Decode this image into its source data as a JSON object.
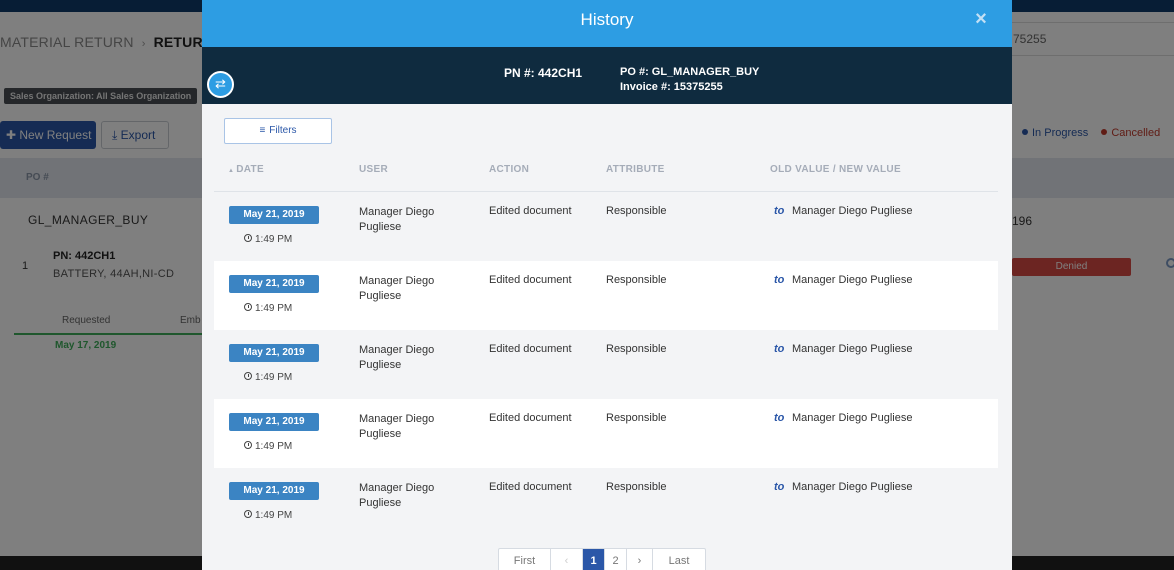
{
  "background": {
    "breadcrumb": {
      "parent": "MATERIAL RETURN",
      "current": "RETURN"
    },
    "search_value": "75255",
    "org_badge": "Sales Organization: All Sales Organization",
    "new_request_label": "New Request",
    "export_label": "Export",
    "legend": {
      "in_progress": "In Progress",
      "cancelled": "Cancelled"
    },
    "table_head_po": "PO #",
    "row_po": "GL_MANAGER_BUY",
    "row_right_value": "196",
    "item": {
      "number": "1",
      "pn": "PN: 442CH1",
      "description": "BATTERY, 44AH,NI-CD"
    },
    "denied_status": "Denied",
    "timeline": {
      "requested": "Requested",
      "emb": "Emb",
      "date": "May 17, 2019"
    }
  },
  "modal": {
    "title": "History",
    "close_glyph": "×",
    "swap_glyph": "⇄",
    "pn_label": "PN #:  442CH1",
    "po_label": "PO #:  GL_MANAGER_BUY",
    "invoice_label": "Invoice #:  15375255",
    "filters_label": "Filters",
    "filters_glyph": "≡",
    "columns": {
      "sort_glyph": "▲",
      "date": "DATE",
      "user": "USER",
      "action": "ACTION",
      "attribute": "ATTRIBUTE",
      "old_new": "OLD VALUE / NEW VALUE"
    },
    "rows": [
      {
        "date": "May 21, 2019",
        "time": "1:49 PM",
        "user": "Manager Diego Pugliese",
        "action": "Edited document",
        "attribute": "Responsible",
        "to": "to",
        "value": "Manager Diego Pugliese"
      },
      {
        "date": "May 21, 2019",
        "time": "1:49 PM",
        "user": "Manager Diego Pugliese",
        "action": "Edited document",
        "attribute": "Responsible",
        "to": "to",
        "value": "Manager Diego Pugliese"
      },
      {
        "date": "May 21, 2019",
        "time": "1:49 PM",
        "user": "Manager Diego Pugliese",
        "action": "Edited document",
        "attribute": "Responsible",
        "to": "to",
        "value": "Manager Diego Pugliese"
      },
      {
        "date": "May 21, 2019",
        "time": "1:49 PM",
        "user": "Manager Diego Pugliese",
        "action": "Edited document",
        "attribute": "Responsible",
        "to": "to",
        "value": "Manager Diego Pugliese"
      },
      {
        "date": "May 21, 2019",
        "time": "1:49 PM",
        "user": "Manager Diego Pugliese",
        "action": "Edited document",
        "attribute": "Responsible",
        "to": "to",
        "value": "Manager Diego Pugliese"
      }
    ],
    "pagination": {
      "first": "First",
      "prev": "‹",
      "pages": [
        "1",
        "2"
      ],
      "active_page": "1",
      "next": "›",
      "last": "Last"
    }
  },
  "colors": {
    "header_blue": "#2d9de3",
    "info_bar": "#0f2b3f",
    "date_badge": "#3b84c3",
    "accent": "#2b57a8",
    "denied": "#d94b45",
    "timeline_green": "#3fae5a"
  }
}
